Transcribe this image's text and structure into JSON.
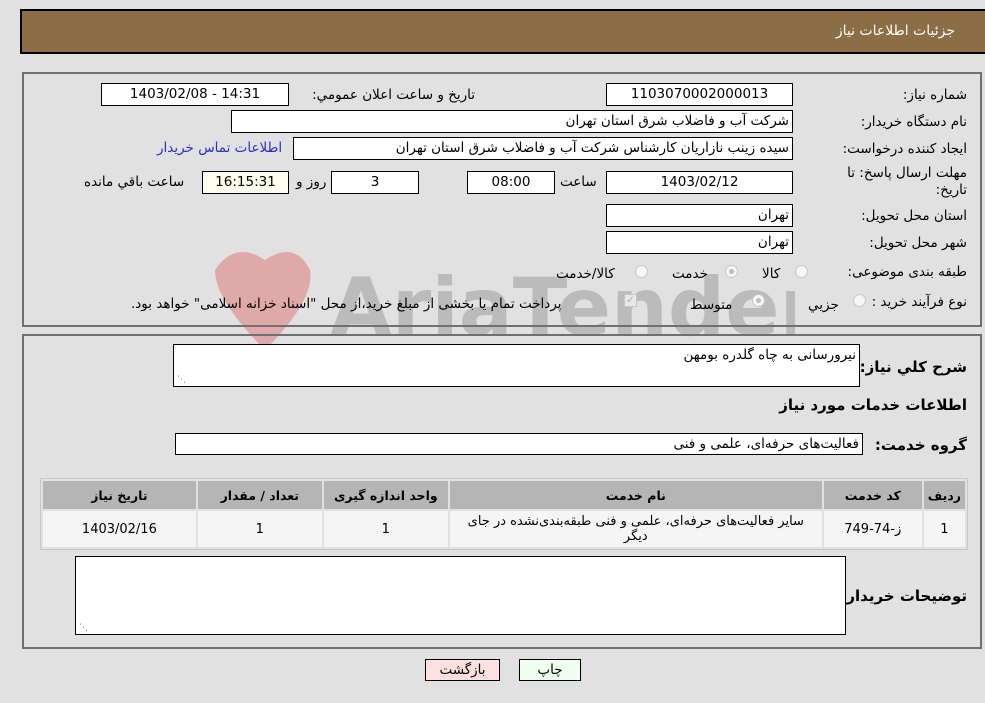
{
  "header": {
    "title": "جزئیات اطلاعات نیاز"
  },
  "form": {
    "need_number": {
      "label": "شماره نیاز:",
      "value": "1103070002000013"
    },
    "announce_datetime": {
      "label": "تاریخ و ساعت اعلان عمومي:",
      "value": "1403/02/08 - 14:31"
    },
    "buyer_org": {
      "label": "نام دستگاه خريدار:",
      "value": "شرکت آب و فاضلاب شرق استان تهران"
    },
    "requester": {
      "label": "ایجاد کننده درخواست:",
      "value": "سیده زینب نازاریان کارشناس شرکت آب و فاضلاب شرق استان تهران"
    },
    "contact_link": "اطلاعات تماس خریدار",
    "deadline": {
      "label": "مهلت ارسال پاسخ: تا تاریخ:",
      "date": "1403/02/12",
      "time_label": "ساعت",
      "time": "08:00",
      "days": "3",
      "days_label": "روز و",
      "remaining": "16:15:31",
      "remaining_label": "ساعت باقي مانده"
    },
    "delivery_province": {
      "label": "استان محل تحویل:",
      "value": "تهران"
    },
    "delivery_city": {
      "label": "شهر محل تحویل:",
      "value": "تهران"
    },
    "category": {
      "label": "طبقه بندی موضوعی:",
      "options": [
        {
          "label": "کالا",
          "selected": false
        },
        {
          "label": "خدمت",
          "selected": true
        },
        {
          "label": "کالا/خدمت",
          "selected": false
        }
      ]
    },
    "purchase_type": {
      "label": "نوع فرآیند خرید :",
      "options": [
        {
          "label": "جزيي",
          "selected": false
        },
        {
          "label": "متوسط",
          "selected": true
        }
      ],
      "treasury_checkbox": {
        "checked": true,
        "label": "پرداخت تمام یا بخشی از مبلغ خرید،از محل \"اسناد خزانه اسلامی\" خواهد بود."
      }
    }
  },
  "details": {
    "description_label": "شرح کلي نیاز:",
    "description_value": "نیرورسانی به چاه گلدره بومهن",
    "services_heading": "اطلاعات خدمات مورد نیاز",
    "service_group_label": "گروه خدمت:",
    "service_group_value": "فعالیت‌های حرفه‌ای، علمی و فنی",
    "table": {
      "headers": [
        "ردیف",
        "کد خدمت",
        "نام خدمت",
        "واحد اندازه گیری",
        "تعداد / مقدار",
        "تاریخ نیاز"
      ],
      "rows": [
        [
          "1",
          "ز-74-749",
          "سایر فعالیت‌های حرفه‌ای، علمی و فنی طبقه‌بندی‌نشده در جای دیگر",
          "1",
          "1",
          "1403/02/16"
        ]
      ]
    },
    "buyer_notes_label": "توضیحات خریدار:",
    "buyer_notes_value": ""
  },
  "buttons": {
    "print": "چاپ",
    "back": "بازگشت"
  },
  "watermark": "AriaTender.neT",
  "colors": {
    "header_bg": "#8c6d45",
    "page_bg": "#e1e1e1",
    "print_bg": "#f0fff0",
    "back_bg": "#ffe0e0"
  }
}
